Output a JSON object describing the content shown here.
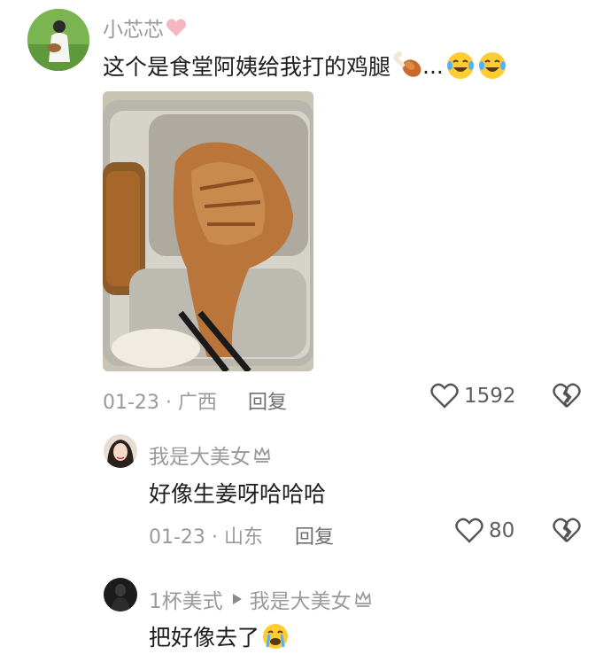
{
  "comments": [
    {
      "user": "小芯芯",
      "text": "这个是食堂阿姨给我打的鸡腿",
      "text_suffix": "...",
      "date": "01-23",
      "location": "广西",
      "reply_label": "回复",
      "likes": "1592"
    },
    {
      "user": "我是大美女",
      "text": "好像生姜呀哈哈哈",
      "date": "01-23",
      "location": "山东",
      "reply_label": "回复",
      "likes": "80"
    },
    {
      "user": "1杯美式",
      "reply_to": "我是大美女",
      "text": "把好像去了"
    }
  ],
  "meta_separator": "·",
  "icons": {
    "heart": "heart-outline-icon",
    "dislike": "broken-heart-icon",
    "crown": "crown-icon",
    "arrow": "triangle-right-icon",
    "chicken_leg": "poultry-leg-emoji",
    "laugh_cry": "tears-of-joy-emoji",
    "crying": "crying-face-emoji"
  },
  "colors": {
    "username": "#9a9a9a",
    "text": "#1d1d1d",
    "meta": "#9a9a9a",
    "pink_heart": "#f5b6c0"
  }
}
